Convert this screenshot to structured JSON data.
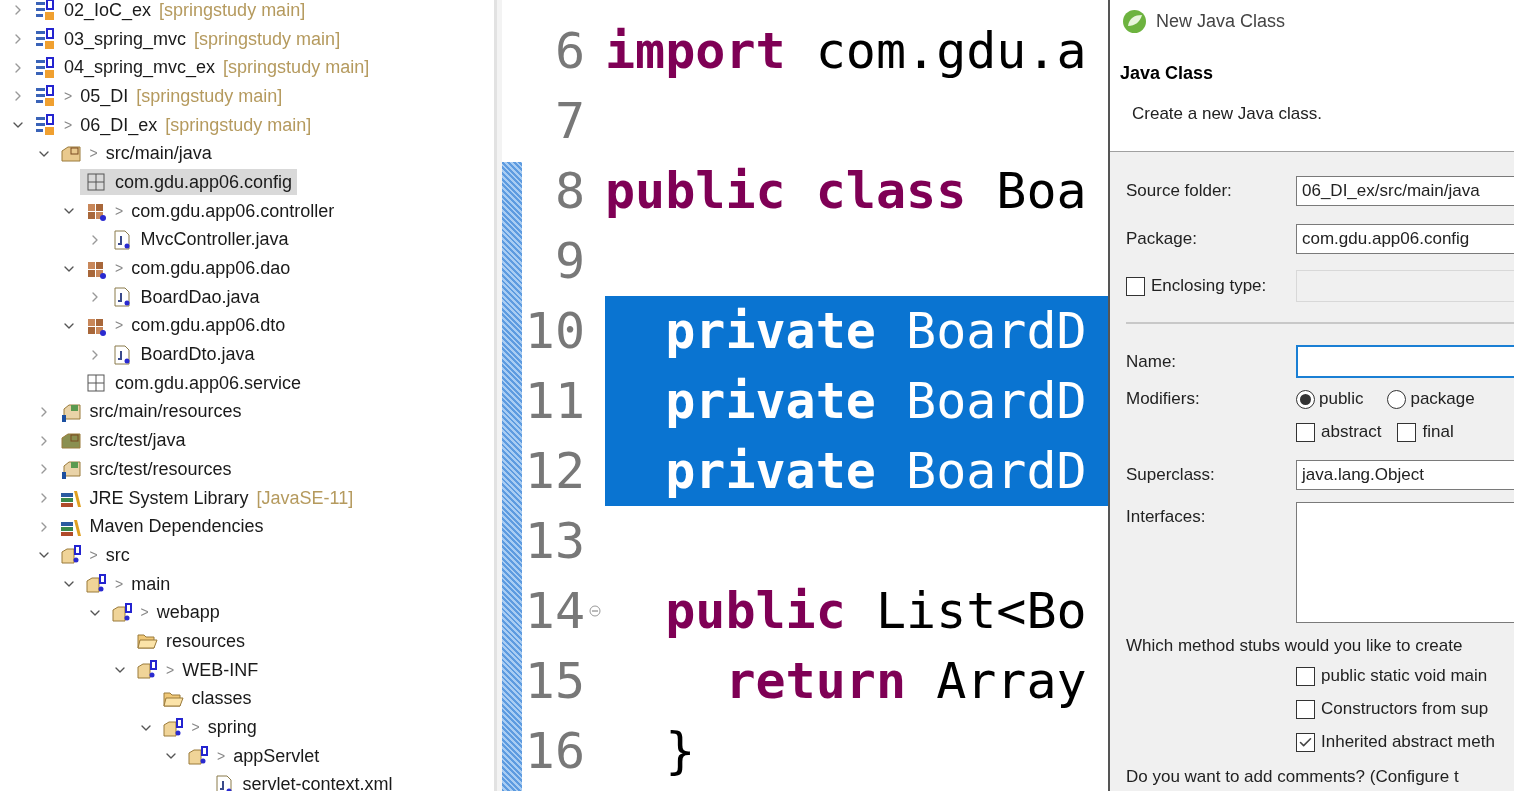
{
  "project_tree": {
    "items": [
      {
        "label": "02_IoC_ex",
        "decoration": "[springstudy main]",
        "kind": "project",
        "expanded": false,
        "selected": false
      },
      {
        "label": "03_spring_mvc",
        "decoration": "[springstudy main]",
        "kind": "project",
        "expanded": false,
        "selected": false
      },
      {
        "label": "04_spring_mvc_ex",
        "decoration": "[springstudy main]",
        "kind": "project",
        "expanded": false,
        "selected": false
      },
      {
        "label": "05_DI",
        "marker": ">",
        "decoration": "[springstudy main]",
        "kind": "project",
        "expanded": false,
        "selected": false
      },
      {
        "label": "06_DI_ex",
        "marker": ">",
        "decoration": "[springstudy main]",
        "kind": "project",
        "expanded": true,
        "selected": false,
        "children": [
          {
            "label": "src/main/java",
            "marker": ">",
            "kind": "source-folder",
            "expanded": true,
            "selected": false,
            "children": [
              {
                "label": "com.gdu.app06.config",
                "kind": "empty-package",
                "selected": true
              },
              {
                "label": "com.gdu.app06.controller",
                "marker": ">",
                "kind": "package",
                "expanded": true,
                "selected": false,
                "children": [
                  {
                    "label": "MvcController.java",
                    "kind": "java-file",
                    "expanded": false,
                    "selected": false
                  }
                ]
              },
              {
                "label": "com.gdu.app06.dao",
                "marker": ">",
                "kind": "package",
                "expanded": true,
                "selected": false,
                "children": [
                  {
                    "label": "BoardDao.java",
                    "kind": "java-file",
                    "expanded": false,
                    "selected": false
                  }
                ]
              },
              {
                "label": "com.gdu.app06.dto",
                "marker": ">",
                "kind": "package",
                "expanded": true,
                "selected": false,
                "children": [
                  {
                    "label": "BoardDto.java",
                    "kind": "java-file",
                    "expanded": false,
                    "selected": false
                  }
                ]
              },
              {
                "label": "com.gdu.app06.service",
                "kind": "empty-package",
                "selected": false
              }
            ]
          },
          {
            "label": "src/main/resources",
            "kind": "resource-folder",
            "expanded": false,
            "selected": false
          },
          {
            "label": "src/test/java",
            "kind": "test-folder",
            "expanded": false,
            "selected": false
          },
          {
            "label": "src/test/resources",
            "kind": "resource-folder",
            "expanded": false,
            "selected": false
          },
          {
            "label": "JRE System Library",
            "decoration": "[JavaSE-11]",
            "kind": "library",
            "expanded": false,
            "selected": false
          },
          {
            "label": "Maven Dependencies",
            "kind": "library",
            "expanded": false,
            "selected": false
          },
          {
            "label": "src",
            "marker": ">",
            "kind": "spring-folder",
            "expanded": true,
            "selected": false,
            "children": [
              {
                "label": "main",
                "marker": ">",
                "kind": "spring-folder",
                "expanded": true,
                "selected": false,
                "children": [
                  {
                    "label": "webapp",
                    "marker": ">",
                    "kind": "spring-folder",
                    "expanded": true,
                    "selected": false,
                    "children": [
                      {
                        "label": "resources",
                        "kind": "folder",
                        "selected": false
                      },
                      {
                        "label": "WEB-INF",
                        "marker": ">",
                        "kind": "spring-folder",
                        "expanded": true,
                        "selected": false,
                        "children": [
                          {
                            "label": "classes",
                            "kind": "folder",
                            "selected": false
                          },
                          {
                            "label": "spring",
                            "marker": ">",
                            "kind": "spring-folder",
                            "expanded": true,
                            "selected": false,
                            "children": [
                              {
                                "label": "appServlet",
                                "marker": ">",
                                "kind": "spring-folder",
                                "expanded": true,
                                "selected": false,
                                "children": [
                                  {
                                    "label": "servlet-context.xml",
                                    "kind": "xml-file",
                                    "selected": false
                                  }
                                ]
                              }
                            ]
                          }
                        ]
                      }
                    ]
                  }
                ]
              }
            ]
          }
        ]
      }
    ]
  },
  "editor": {
    "lines": [
      {
        "number": "6",
        "selected": false,
        "foldable": false,
        "segments": [
          {
            "text": "import",
            "kind": "keyword"
          },
          {
            "text": " com.gdu.a",
            "kind": "plain"
          }
        ]
      },
      {
        "number": "7",
        "selected": false,
        "foldable": false
      },
      {
        "number": "8",
        "selected": false,
        "foldable": false,
        "segments": [
          {
            "text": "public class",
            "kind": "keyword"
          },
          {
            "text": " Boa",
            "kind": "plain"
          }
        ]
      },
      {
        "number": "9",
        "selected": false,
        "foldable": false
      },
      {
        "number": "10",
        "selected": true,
        "foldable": false,
        "segments": [
          {
            "text": "  private",
            "kind": "keyword"
          },
          {
            "text": " BoardD",
            "kind": "plain"
          }
        ]
      },
      {
        "number": "11",
        "selected": true,
        "foldable": false,
        "segments": [
          {
            "text": "  private",
            "kind": "keyword"
          },
          {
            "text": " BoardD",
            "kind": "plain"
          }
        ]
      },
      {
        "number": "12",
        "selected": true,
        "foldable": false,
        "segments": [
          {
            "text": "  private",
            "kind": "keyword"
          },
          {
            "text": " BoardD",
            "kind": "plain"
          }
        ]
      },
      {
        "number": "13",
        "selected": false,
        "foldable": false
      },
      {
        "number": "14",
        "selected": false,
        "foldable": true,
        "segments": [
          {
            "text": "  public",
            "kind": "keyword"
          },
          {
            "text": " List<Bo",
            "kind": "plain"
          }
        ]
      },
      {
        "number": "15",
        "selected": false,
        "foldable": false,
        "segments": [
          {
            "text": "    return",
            "kind": "keyword"
          },
          {
            "text": " Array",
            "kind": "plain"
          }
        ]
      },
      {
        "number": "16",
        "selected": false,
        "foldable": false,
        "segments": [
          {
            "text": "  }",
            "kind": "plain"
          }
        ]
      }
    ]
  },
  "dialog": {
    "title": "New Java Class",
    "heading": "Java Class",
    "description": "Create a new Java class.",
    "source_folder": {
      "label": "Source folder:",
      "value": "06_DI_ex/src/main/java"
    },
    "package": {
      "label": "Package:",
      "value": "com.gdu.app06.config"
    },
    "enclosing_type": {
      "label": "Enclosing type:",
      "checked": false
    },
    "name": {
      "label": "Name:",
      "focused": true
    },
    "modifiers": {
      "label": "Modifiers:",
      "visibility": [
        {
          "label": "public",
          "selected": true
        },
        {
          "label": "package",
          "selected": false
        }
      ],
      "flags": [
        {
          "label": "abstract",
          "checked": false
        },
        {
          "label": "final",
          "checked": false
        }
      ]
    },
    "superclass": {
      "label": "Superclass:",
      "value": "java.lang.Object"
    },
    "interfaces": {
      "label": "Interfaces:"
    },
    "method_stubs": {
      "question": "Which method stubs would you like to create",
      "options": [
        {
          "label": "public static void main",
          "checked": false
        },
        {
          "label": "Constructors from sup",
          "checked": false
        },
        {
          "label": "Inherited abstract meth",
          "checked": true
        }
      ]
    },
    "comments_question": "Do you want to add comments? (Configure t"
  }
}
